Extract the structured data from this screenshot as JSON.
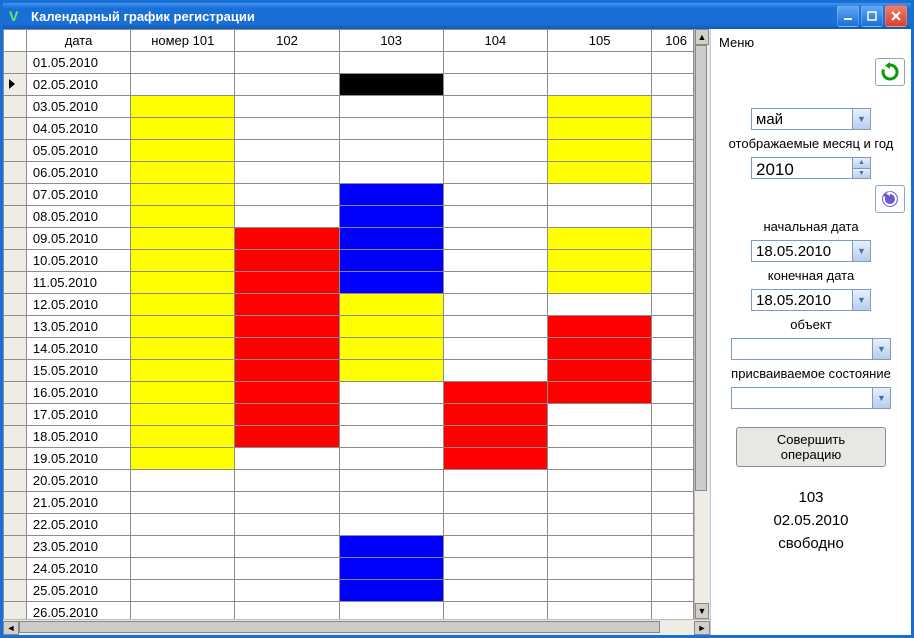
{
  "title": "Календарный график регистрации",
  "columns": [
    "дата",
    "номер 101",
    "102",
    "103",
    "104",
    "105",
    "106"
  ],
  "rows": [
    {
      "date": "01.05.2010",
      "cells": [
        "",
        "",
        "",
        "",
        "",
        ""
      ]
    },
    {
      "date": "02.05.2010",
      "marker": true,
      "cells": [
        "",
        "",
        "black",
        "",
        "",
        ""
      ]
    },
    {
      "date": "03.05.2010",
      "cells": [
        "yellow",
        "",
        "",
        "",
        "yellow",
        ""
      ]
    },
    {
      "date": "04.05.2010",
      "cells": [
        "yellow",
        "",
        "",
        "",
        "yellow",
        ""
      ]
    },
    {
      "date": "05.05.2010",
      "cells": [
        "yellow",
        "",
        "",
        "",
        "yellow",
        ""
      ]
    },
    {
      "date": "06.05.2010",
      "cells": [
        "yellow",
        "",
        "",
        "",
        "yellow",
        ""
      ]
    },
    {
      "date": "07.05.2010",
      "cells": [
        "yellow",
        "",
        "blue",
        "",
        "",
        ""
      ]
    },
    {
      "date": "08.05.2010",
      "cells": [
        "yellow",
        "",
        "blue",
        "",
        "",
        ""
      ]
    },
    {
      "date": "09.05.2010",
      "cells": [
        "yellow",
        "red",
        "blue",
        "",
        "yellow",
        ""
      ]
    },
    {
      "date": "10.05.2010",
      "cells": [
        "yellow",
        "red",
        "blue",
        "",
        "yellow",
        ""
      ]
    },
    {
      "date": "11.05.2010",
      "cells": [
        "yellow",
        "red",
        "blue",
        "",
        "yellow",
        ""
      ]
    },
    {
      "date": "12.05.2010",
      "cells": [
        "yellow",
        "red",
        "yellow",
        "",
        "",
        ""
      ]
    },
    {
      "date": "13.05.2010",
      "cells": [
        "yellow",
        "red",
        "yellow",
        "",
        "red",
        ""
      ]
    },
    {
      "date": "14.05.2010",
      "cells": [
        "yellow",
        "red",
        "yellow",
        "",
        "red",
        ""
      ]
    },
    {
      "date": "15.05.2010",
      "cells": [
        "yellow",
        "red",
        "yellow",
        "",
        "red",
        ""
      ]
    },
    {
      "date": "16.05.2010",
      "cells": [
        "yellow",
        "red",
        "",
        "red",
        "red",
        ""
      ]
    },
    {
      "date": "17.05.2010",
      "cells": [
        "yellow",
        "red",
        "",
        "red",
        "",
        ""
      ]
    },
    {
      "date": "18.05.2010",
      "cells": [
        "yellow",
        "red",
        "",
        "red",
        "",
        ""
      ]
    },
    {
      "date": "19.05.2010",
      "cells": [
        "yellow",
        "",
        "",
        "red",
        "",
        ""
      ]
    },
    {
      "date": "20.05.2010",
      "cells": [
        "",
        "",
        "",
        "",
        "",
        ""
      ]
    },
    {
      "date": "21.05.2010",
      "cells": [
        "",
        "",
        "",
        "",
        "",
        ""
      ]
    },
    {
      "date": "22.05.2010",
      "cells": [
        "",
        "",
        "",
        "",
        "",
        ""
      ]
    },
    {
      "date": "23.05.2010",
      "cells": [
        "",
        "",
        "blue",
        "",
        "",
        ""
      ]
    },
    {
      "date": "24.05.2010",
      "cells": [
        "",
        "",
        "blue",
        "",
        "",
        ""
      ]
    },
    {
      "date": "25.05.2010",
      "cells": [
        "",
        "",
        "blue",
        "",
        "",
        ""
      ]
    },
    {
      "date": "26.05.2010",
      "cells": [
        "",
        "",
        "",
        "",
        "",
        ""
      ]
    }
  ],
  "sidebar": {
    "menu_label": "Меню",
    "month_value": "май",
    "month_year_label": "отображаемые месяц и год",
    "year_value": "2010",
    "start_date_label": "начальная дата",
    "start_date_value": "18.05.2010",
    "end_date_label": "конечная дата",
    "end_date_value": "18.05.2010",
    "object_label": "объект",
    "object_value": "",
    "state_label": "присваиваемое состояние",
    "state_value": "",
    "op_button": "Совершить операцию",
    "status_room": "103",
    "status_date": "02.05.2010",
    "status_state": "свободно"
  }
}
